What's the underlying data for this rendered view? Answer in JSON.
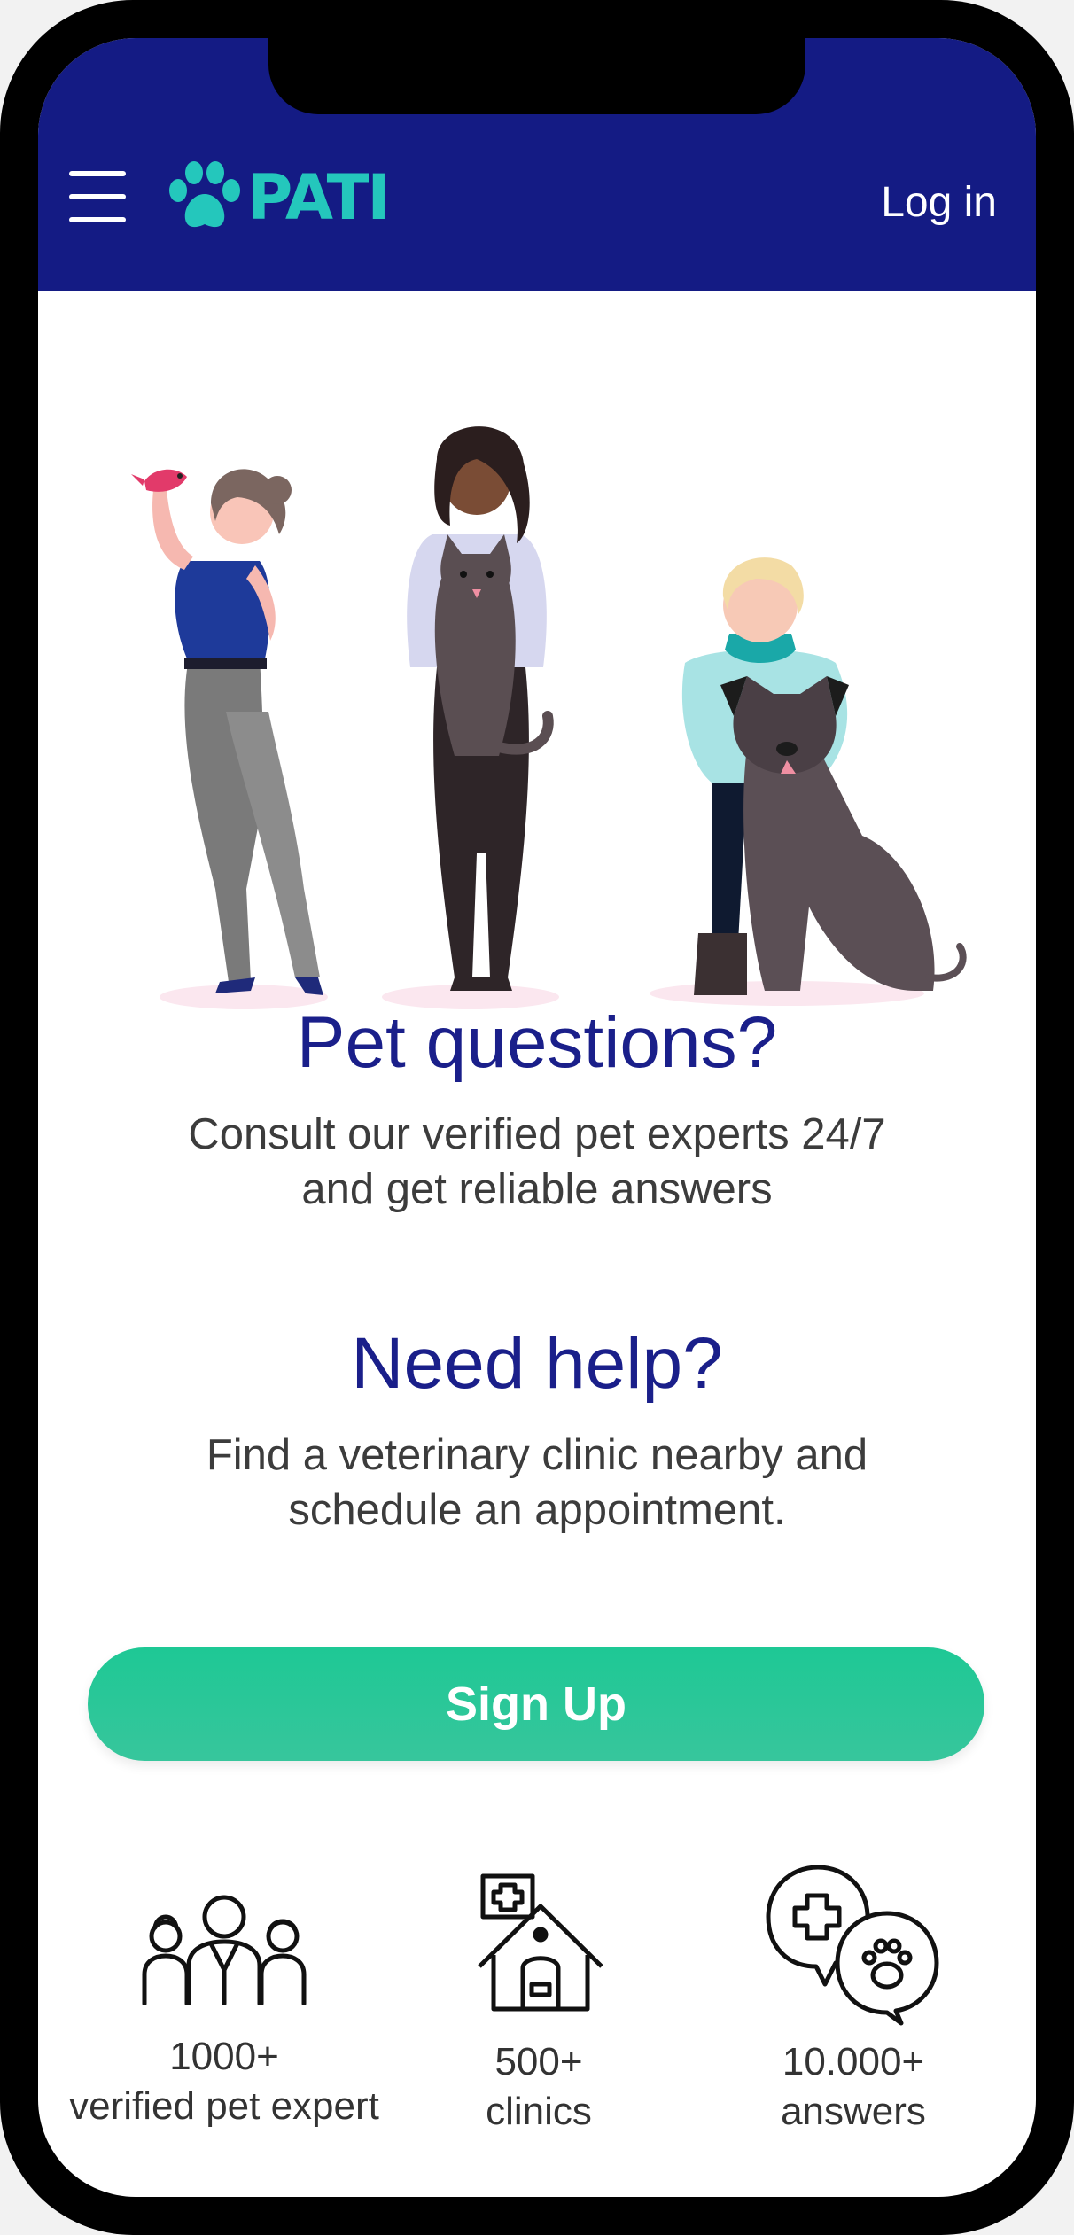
{
  "header": {
    "brand": "PATI",
    "login_label": "Log in",
    "menu_icon": "hamburger-menu-icon",
    "logo_icon": "paw-icon",
    "background_color": "#141b84",
    "brand_color": "#24c7bc"
  },
  "intro": {
    "question_title": "Pet questions?",
    "question_text_line1": "Consult our verified pet experts 24/7",
    "question_text_line2": "and get reliable answers",
    "help_title": "Need help?",
    "help_text_line1": "Find a veterinary clinic nearby and",
    "help_text_line2": "schedule an appointment.",
    "title_color": "#1a1f8a"
  },
  "cta": {
    "signup_label": "Sign Up",
    "color": "#1ec895"
  },
  "stats": [
    {
      "icon": "people-group-icon",
      "value": "1000+",
      "label": "verified pet expert"
    },
    {
      "icon": "vet-clinic-icon",
      "value": "500+",
      "label": "clinics"
    },
    {
      "icon": "chat-bubbles-icon",
      "value": "10.000+",
      "label": "answers"
    }
  ]
}
